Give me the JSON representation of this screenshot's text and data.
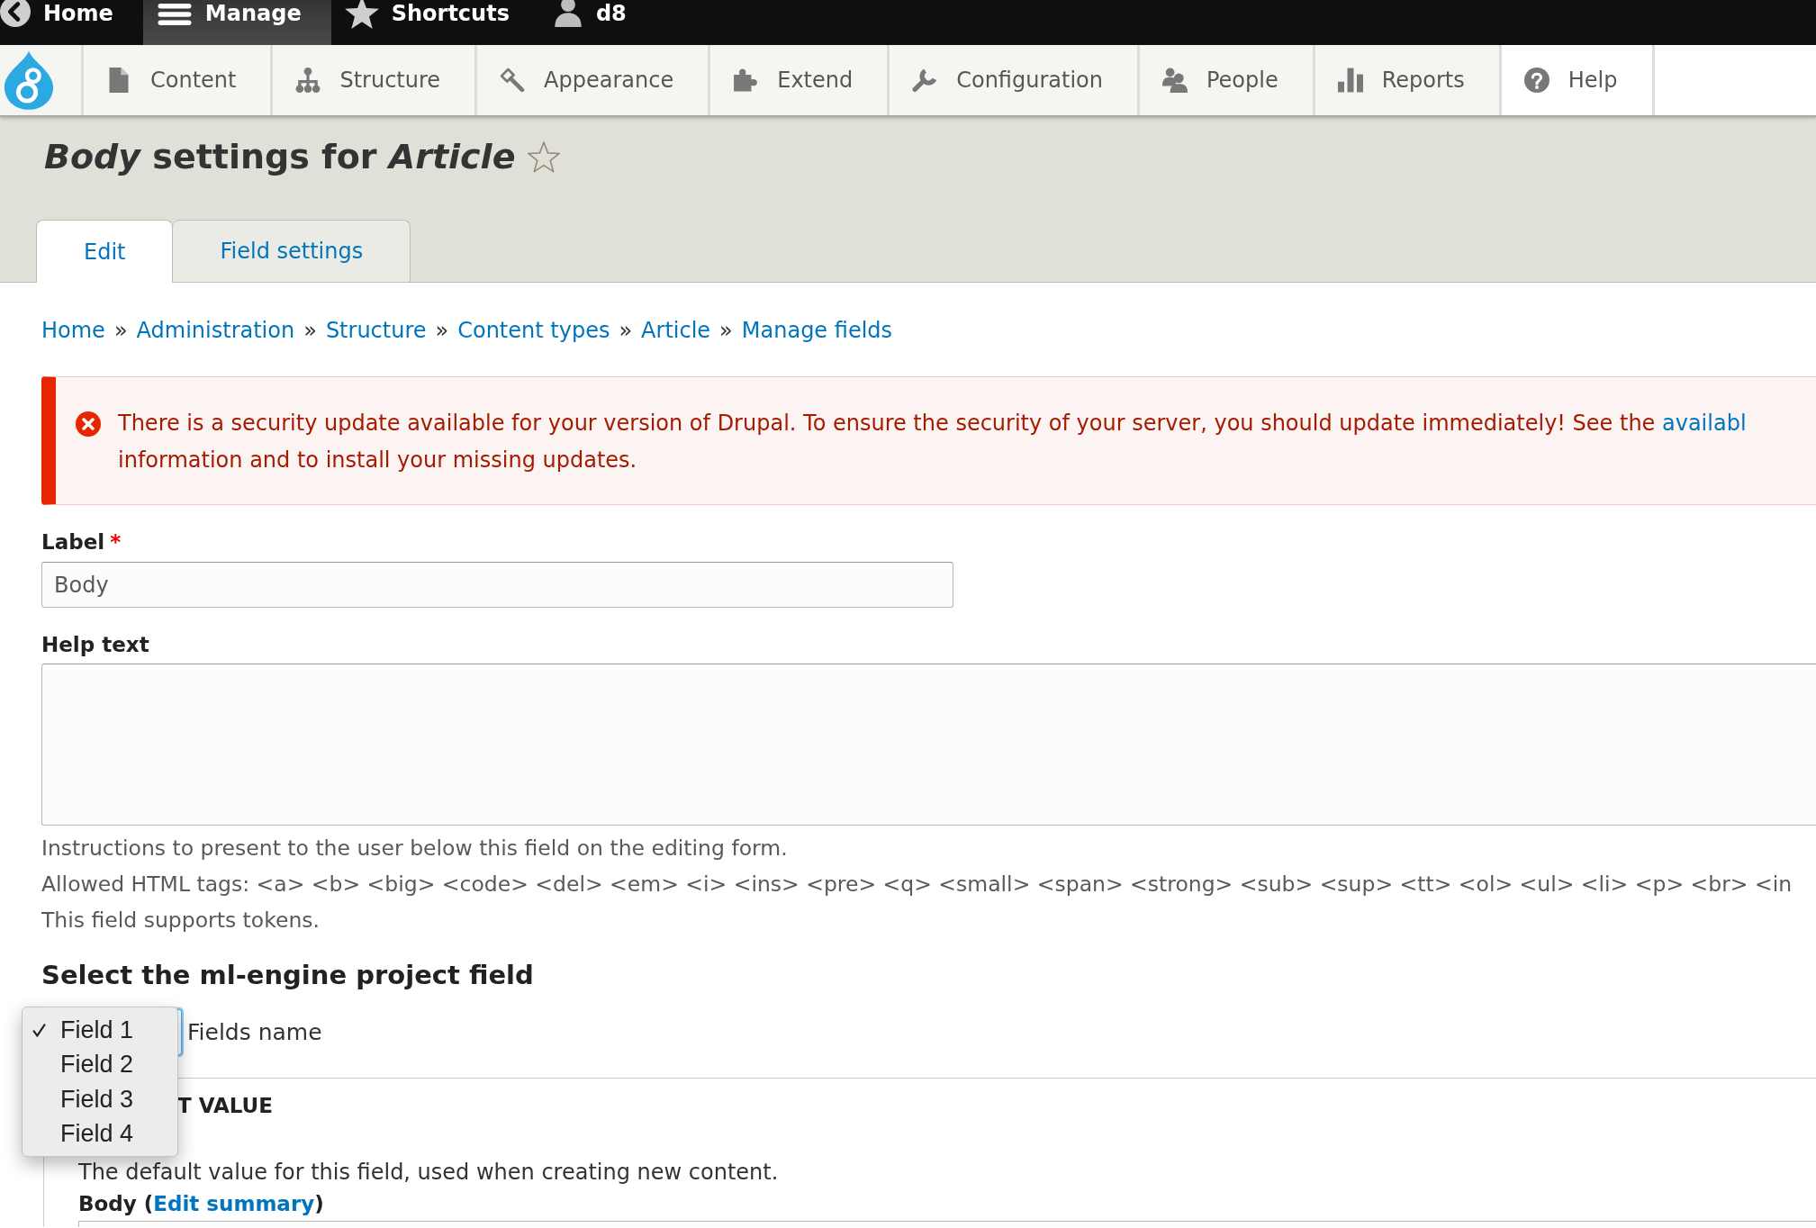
{
  "toolbar": {
    "items": [
      {
        "label": "Home",
        "selected": false
      },
      {
        "label": "Manage",
        "selected": true
      },
      {
        "label": "Shortcuts",
        "selected": false
      },
      {
        "label": "d8",
        "selected": false
      }
    ]
  },
  "tray": {
    "items": [
      {
        "label": "Content",
        "highlighted": false
      },
      {
        "label": "Structure",
        "highlighted": false
      },
      {
        "label": "Appearance",
        "highlighted": false
      },
      {
        "label": "Extend",
        "highlighted": false
      },
      {
        "label": "Configuration",
        "highlighted": false
      },
      {
        "label": "People",
        "highlighted": false
      },
      {
        "label": "Reports",
        "highlighted": false
      },
      {
        "label": "Help",
        "highlighted": true
      }
    ]
  },
  "page_title": "*Body* settings for *Article*",
  "tabs": [
    {
      "label": "Edit",
      "selected": true
    },
    {
      "label": "Field settings",
      "selected": false
    }
  ],
  "breadcrumb": {
    "links": [
      "Home",
      "Administration",
      "Structure",
      "Content types",
      "Article",
      "Manage fields"
    ],
    "separators": [
      "»",
      "»",
      "»",
      "»",
      "»"
    ]
  },
  "message": {
    "kind": "error",
    "text": "There is a security update available for your version of Drupal. To ensure the security of your server, you should update immediately! See the",
    "link": "availabl",
    "text_after": "information and to install your missing updates."
  },
  "label_field": {
    "label": "Label",
    "required_mark": "*",
    "value": "Body"
  },
  "help_text_field": {
    "label": "Help text",
    "descriptions": [
      "Instructions to present to the user below this field on the editing form.",
      "Allowed HTML tags: <a> <b> <big> <code> <del> <em> <i> <ins> <pre> <q> <small> <span> <strong> <sub> <sup> <tt> <ol> <ul> <li> <p> <br> <in",
      "This field supports tokens."
    ]
  },
  "ml_engine": {
    "heading": "Select the ml-engine project field",
    "select_label": "Fields name",
    "expanded": true,
    "options": [
      {
        "label": "Field 1",
        "selected": true
      },
      {
        "label": "Field 2",
        "selected": false
      },
      {
        "label": "Field 3",
        "selected": false
      },
      {
        "label": "Field 4",
        "selected": false
      }
    ]
  },
  "default_value": {
    "heading": "T VALUE",
    "description": "The default value for this field, used when creating new content.",
    "body_label": "Body (",
    "summary_link": "Edit summary",
    "body_label_end": ")"
  }
}
